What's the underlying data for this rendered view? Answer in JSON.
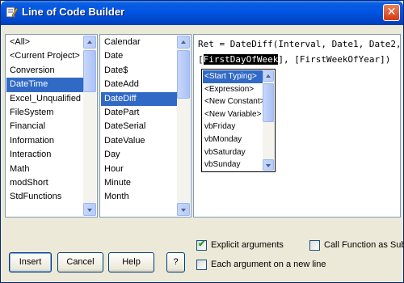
{
  "window": {
    "title": "Line of Code Builder",
    "close_glyph": "✕"
  },
  "modules": {
    "items": [
      "<All>",
      "<Current Project>",
      "Conversion",
      "DateTime",
      "Excel_Unqualified",
      "FileSystem",
      "Financial",
      "Information",
      "Interaction",
      "Math",
      "modShort",
      "StdFunctions"
    ],
    "selected": "DateTime"
  },
  "functions": {
    "items": [
      "Calendar",
      "Date",
      "Date$",
      "DateAdd",
      "DateDiff",
      "DatePart",
      "DateSerial",
      "DateValue",
      "Day",
      "Hour",
      "Minute",
      "Month"
    ],
    "selected": "DateDiff"
  },
  "code": {
    "line1": "Ret = DateDiff(Interval, Date1, Date2,",
    "line2_before": "[",
    "line2_highlight": "FirstDayOfWeek",
    "line2_after": "], [FirstWeekOfYear])"
  },
  "popup": {
    "items": [
      "<Start Typing>",
      "<Expression>",
      "<New Constant>",
      "<New Variable>",
      "vbFriday",
      "vbMonday",
      "vbSaturday",
      "vbSunday"
    ],
    "selected": "<Start Typing>"
  },
  "options": {
    "explicit_arguments": {
      "label": "Explicit arguments",
      "checked": true
    },
    "each_argument_new_line": {
      "label": "Each argument on a new line",
      "checked": false
    },
    "call_function_as_sub": {
      "label": "Call Function as Sub",
      "checked": false
    }
  },
  "buttons": {
    "insert": "Insert",
    "cancel": "Cancel",
    "help": "Help",
    "about": "?"
  },
  "icons": [
    "app-icon",
    "close-icon",
    "scroll-up-icon",
    "scroll-down-icon",
    "checkmark-icon"
  ],
  "colors": {
    "titlebar": "#0054e3",
    "selection": "#316ac5",
    "dialog_bg": "#ece9d8",
    "highlight_bg": "#000000"
  }
}
